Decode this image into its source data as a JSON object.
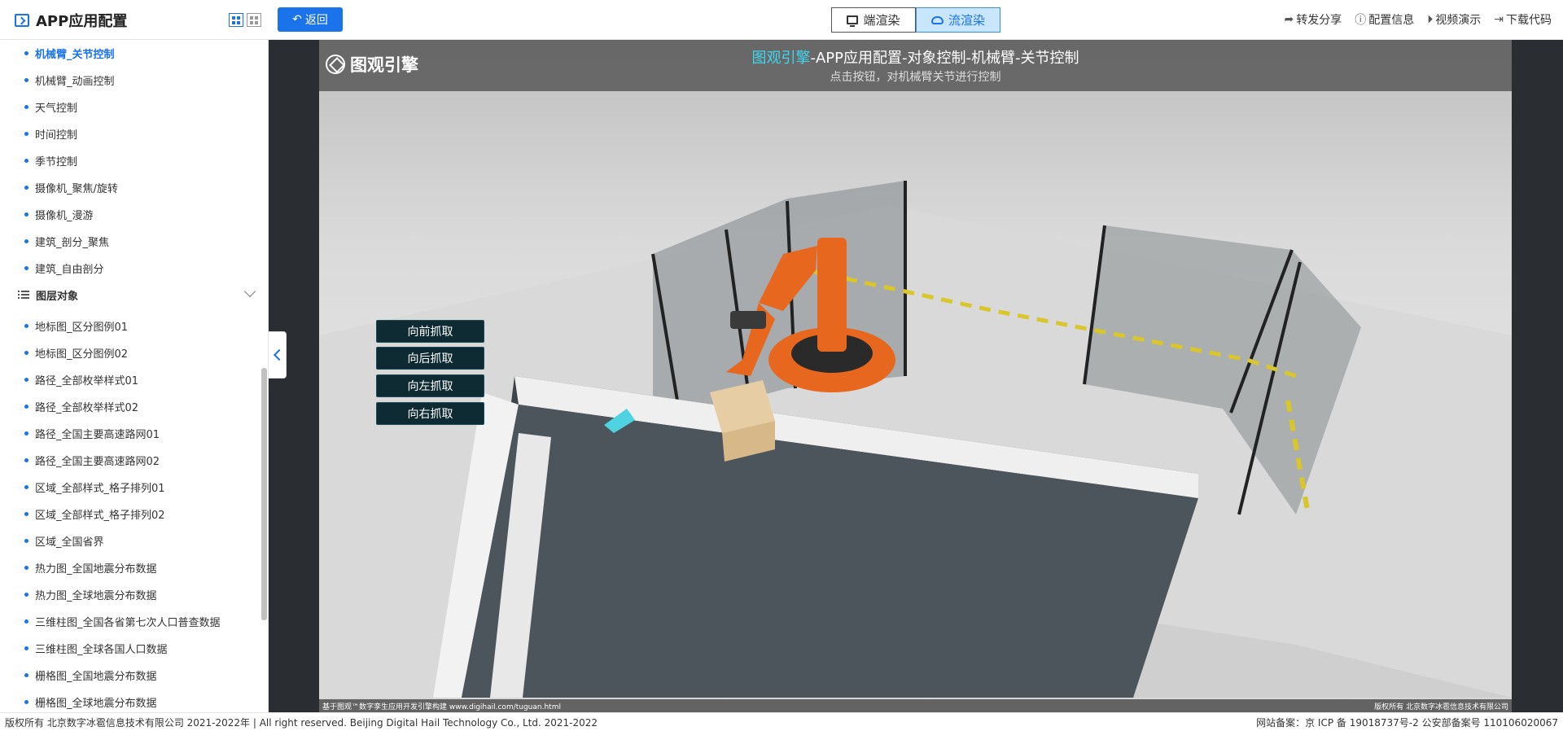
{
  "app": {
    "title": "APP应用配置"
  },
  "header": {
    "back_label": "返回",
    "render_modes": [
      "端渲染",
      "流渲染"
    ],
    "actions": [
      "转发分享",
      "配置信息",
      "视频演示",
      "下载代码"
    ]
  },
  "sidebar": {
    "items_top": [
      "机械臂_关节控制",
      "机械臂_动画控制",
      "天气控制",
      "时间控制",
      "季节控制",
      "摄像机_聚焦/旋转",
      "摄像机_漫游",
      "建筑_剖分_聚焦",
      "建筑_自由剖分"
    ],
    "group_label": "图层对象",
    "items_layer": [
      "地标图_区分图例01",
      "地标图_区分图例02",
      "路径_全部枚举样式01",
      "路径_全部枚举样式02",
      "路径_全国主要高速路网01",
      "路径_全国主要高速路网02",
      "区域_全部样式_格子排列01",
      "区域_全部样式_格子排列02",
      "区域_全国省界",
      "热力图_全国地震分布数据",
      "热力图_全球地震分布数据",
      "三维柱图_全国各省第七次人口普查数据",
      "三维柱图_全球各国人口数据",
      "栅格图_全国地震分布数据",
      "栅格图_全球地震分布数据"
    ]
  },
  "viewport": {
    "logo_text": "图观引擎",
    "title_brand": "图观引擎",
    "title_rest": "-APP应用配置-对象控制-机械臂-关节控制",
    "subtitle": "点击按钮，对机械臂关节进行控制",
    "buttons": [
      "向前抓取",
      "向后抓取",
      "向左抓取",
      "向右抓取"
    ],
    "footer_left": "基于图观™数字孪生应用开发引擎构建 www.digihail.com/tuguan.html",
    "footer_right": "版权所有 北京数字冰雹信息技术有限公司"
  },
  "footer": {
    "left": "版权所有 北京数字冰雹信息技术有限公司 2021-2022年 | All right reserved. Beijing Digital Hail Technology Co., Ltd. 2021-2022",
    "right": "网站备案：京 ICP 备 19018737号-2 公安部备案号 110106020067"
  },
  "colors": {
    "accent": "#1a73e8",
    "title_highlight": "#3ed6f0",
    "robot": "#e8671f",
    "button_bg": "#0e2a33"
  },
  "icons": {
    "app": "terminal-icon",
    "back": "undo-arrow-icon",
    "share": "share-arrow-icon",
    "info": "info-circle-icon",
    "video": "play-circle-icon",
    "download": "exit-icon"
  }
}
